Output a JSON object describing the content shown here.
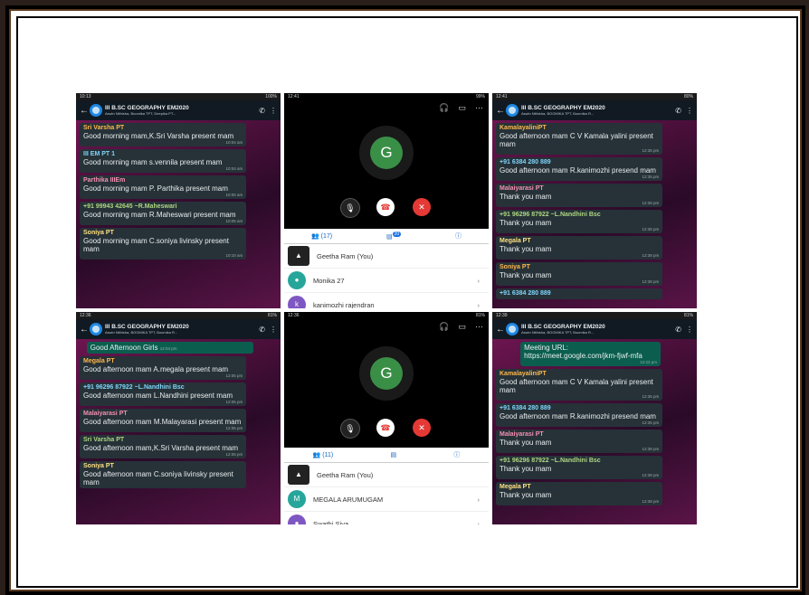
{
  "colors": {
    "accent": "#3a8f47",
    "end_call": "#e53935",
    "chat_bg": "#5a1447"
  },
  "panels": {
    "p1": {
      "status_left": "10:13",
      "status_right": "100%",
      "title": "III B.SC GEOGRAPHY EM2020",
      "subtitle": "Aswin Nithisha, Boomika TPT, Deepika PT...",
      "messages": [
        {
          "sender": "Sri Varsha PT",
          "text": "Good morning mam,K.Sri Varsha present mam",
          "time": "10:04 am"
        },
        {
          "sender": "III EM PT 1",
          "text": "Good morning mam s.vennila present mam",
          "time": "10:04 am"
        },
        {
          "sender": "Parthika IIIEm",
          "text": "Good morning mam P. Parthika present mam",
          "time": "10:05 am"
        },
        {
          "sender": "+91 99943 42645  ~R.Maheswari",
          "text": "Good morning mam R.Maheswari present mam",
          "time": "10:05 am"
        },
        {
          "sender": "Soniya PT",
          "text": "Good morning mam C.soniya livinsky present mam",
          "time": "10:10 am"
        }
      ]
    },
    "p2": {
      "status_left": "12:41",
      "status_right": "99%",
      "avatar": "G",
      "tab_people": "(17)",
      "tab_chat_badge": "20",
      "participants": [
        {
          "name": "Geetha Ram (You)",
          "avatar": "▲"
        },
        {
          "name": "Monika 27",
          "avatar": "●"
        },
        {
          "name": "kanimozhi rajendran",
          "avatar": "k"
        }
      ]
    },
    "p3": {
      "status_left": "12:41",
      "status_right": "80%",
      "title": "III B.SC GEOGRAPHY EM2020",
      "subtitle": "Aswin Nithisha, BOOMIKA TPT, Boomika R...",
      "messages": [
        {
          "sender": "KamalayaliniPT",
          "text": "Good afternoon mam C V Kamala yalini present mam",
          "time": "12:35 pm"
        },
        {
          "sender": "+91 6384 280 889",
          "text": "Good afternoon mam R.kanimozhi presend mam",
          "time": "12:35 pm"
        },
        {
          "sender": "Malaiyarasi PT",
          "text": "Thank you mam",
          "time": "12:38 pm"
        },
        {
          "sender": "+91 96296 87922  ~L.Nandhini Bsc",
          "text": "Thank you mam",
          "time": "12:38 pm"
        },
        {
          "sender": "Megala PT",
          "text": "Thank you mam",
          "time": "12:38 pm"
        },
        {
          "sender": "Soniya PT",
          "text": "Thank you mam",
          "time": "12:38 pm"
        },
        {
          "sender": "+91 6384 280 889",
          "text": "",
          "time": ""
        }
      ]
    },
    "p4": {
      "status_left": "12:36",
      "status_right": "81%",
      "title": "III B.SC GEOGRAPHY EM2020",
      "subtitle": "Aswin Nithisha, BOOMIKA TPT, Boomika R...",
      "outgoing": {
        "text": "Good Afternoon Girls",
        "time": "12:04 pm"
      },
      "messages": [
        {
          "sender": "Megala PT",
          "text": "Good afternoon mam A.megala present mam",
          "time": "12:05 pm"
        },
        {
          "sender": "+91 96296 87922  ~L.Nandhini Bsc",
          "text": "Good afternoon mam L.Nandhini present mam",
          "time": "12:05 pm"
        },
        {
          "sender": "Malaiyarasi PT",
          "text": "Good afternoon mam M.Malayarasi present mam",
          "time": "12:05 pm"
        },
        {
          "sender": "Sri Varsha PT",
          "text": "Good afternoon mam,K.Sri Varsha present mam",
          "time": "12:05 pm"
        },
        {
          "sender": "Soniya PT",
          "text": "Good afternoon mam C.soniya livinsky present mam",
          "time": ""
        }
      ]
    },
    "p5": {
      "status_left": "12:36",
      "status_right": "81%",
      "avatar": "G",
      "tab_people": "(11)",
      "participants": [
        {
          "name": "Geetha Ram (You)",
          "avatar": "▲"
        },
        {
          "name": "MEGALA ARUMUGAM",
          "avatar": "M"
        },
        {
          "name": "Swathi Siva",
          "avatar": "●"
        }
      ]
    },
    "p6": {
      "status_left": "12:39",
      "status_right": "81%",
      "title": "III B.SC GEOGRAPHY EM2020",
      "subtitle": "Aswin Nithisha, BOOMIKA TPT, Boomika R...",
      "outgoing": {
        "text": "Meeting URL: https://meet.google.com/jkm-fjwf-mfa",
        "time": "12:23 pm"
      },
      "messages": [
        {
          "sender": "KamalayaliniPT",
          "text": "Good afternoon mam C V Kamala yalini present mam",
          "time": "12:35 pm"
        },
        {
          "sender": "+91 6384 280 889",
          "text": "Good afternoon mam R.kanimozhi presend mam",
          "time": "12:35 pm"
        },
        {
          "sender": "Malaiyarasi PT",
          "text": "Thank you mam",
          "time": "12:38 pm"
        },
        {
          "sender": "+91 96296 87922  ~L.Nandhini Bsc",
          "text": "Thank you mam",
          "time": "12:38 pm"
        },
        {
          "sender": "Megala PT",
          "text": "Thank you mam",
          "time": "12:38 pm"
        }
      ]
    }
  }
}
